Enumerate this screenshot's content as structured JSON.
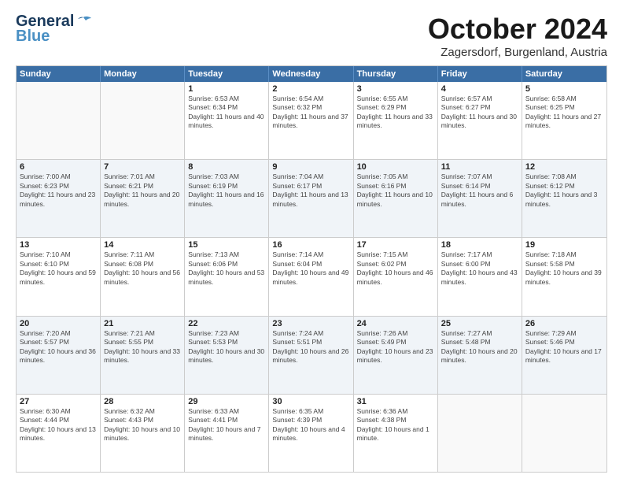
{
  "logo": {
    "line1": "General",
    "line2": "Blue"
  },
  "title": "October 2024",
  "subtitle": "Zagersdorf, Burgenland, Austria",
  "days": [
    "Sunday",
    "Monday",
    "Tuesday",
    "Wednesday",
    "Thursday",
    "Friday",
    "Saturday"
  ],
  "rows": [
    [
      {
        "day": "",
        "info": ""
      },
      {
        "day": "",
        "info": ""
      },
      {
        "day": "1",
        "info": "Sunrise: 6:53 AM\nSunset: 6:34 PM\nDaylight: 11 hours and 40 minutes."
      },
      {
        "day": "2",
        "info": "Sunrise: 6:54 AM\nSunset: 6:32 PM\nDaylight: 11 hours and 37 minutes."
      },
      {
        "day": "3",
        "info": "Sunrise: 6:55 AM\nSunset: 6:29 PM\nDaylight: 11 hours and 33 minutes."
      },
      {
        "day": "4",
        "info": "Sunrise: 6:57 AM\nSunset: 6:27 PM\nDaylight: 11 hours and 30 minutes."
      },
      {
        "day": "5",
        "info": "Sunrise: 6:58 AM\nSunset: 6:25 PM\nDaylight: 11 hours and 27 minutes."
      }
    ],
    [
      {
        "day": "6",
        "info": "Sunrise: 7:00 AM\nSunset: 6:23 PM\nDaylight: 11 hours and 23 minutes."
      },
      {
        "day": "7",
        "info": "Sunrise: 7:01 AM\nSunset: 6:21 PM\nDaylight: 11 hours and 20 minutes."
      },
      {
        "day": "8",
        "info": "Sunrise: 7:03 AM\nSunset: 6:19 PM\nDaylight: 11 hours and 16 minutes."
      },
      {
        "day": "9",
        "info": "Sunrise: 7:04 AM\nSunset: 6:17 PM\nDaylight: 11 hours and 13 minutes."
      },
      {
        "day": "10",
        "info": "Sunrise: 7:05 AM\nSunset: 6:16 PM\nDaylight: 11 hours and 10 minutes."
      },
      {
        "day": "11",
        "info": "Sunrise: 7:07 AM\nSunset: 6:14 PM\nDaylight: 11 hours and 6 minutes."
      },
      {
        "day": "12",
        "info": "Sunrise: 7:08 AM\nSunset: 6:12 PM\nDaylight: 11 hours and 3 minutes."
      }
    ],
    [
      {
        "day": "13",
        "info": "Sunrise: 7:10 AM\nSunset: 6:10 PM\nDaylight: 10 hours and 59 minutes."
      },
      {
        "day": "14",
        "info": "Sunrise: 7:11 AM\nSunset: 6:08 PM\nDaylight: 10 hours and 56 minutes."
      },
      {
        "day": "15",
        "info": "Sunrise: 7:13 AM\nSunset: 6:06 PM\nDaylight: 10 hours and 53 minutes."
      },
      {
        "day": "16",
        "info": "Sunrise: 7:14 AM\nSunset: 6:04 PM\nDaylight: 10 hours and 49 minutes."
      },
      {
        "day": "17",
        "info": "Sunrise: 7:15 AM\nSunset: 6:02 PM\nDaylight: 10 hours and 46 minutes."
      },
      {
        "day": "18",
        "info": "Sunrise: 7:17 AM\nSunset: 6:00 PM\nDaylight: 10 hours and 43 minutes."
      },
      {
        "day": "19",
        "info": "Sunrise: 7:18 AM\nSunset: 5:58 PM\nDaylight: 10 hours and 39 minutes."
      }
    ],
    [
      {
        "day": "20",
        "info": "Sunrise: 7:20 AM\nSunset: 5:57 PM\nDaylight: 10 hours and 36 minutes."
      },
      {
        "day": "21",
        "info": "Sunrise: 7:21 AM\nSunset: 5:55 PM\nDaylight: 10 hours and 33 minutes."
      },
      {
        "day": "22",
        "info": "Sunrise: 7:23 AM\nSunset: 5:53 PM\nDaylight: 10 hours and 30 minutes."
      },
      {
        "day": "23",
        "info": "Sunrise: 7:24 AM\nSunset: 5:51 PM\nDaylight: 10 hours and 26 minutes."
      },
      {
        "day": "24",
        "info": "Sunrise: 7:26 AM\nSunset: 5:49 PM\nDaylight: 10 hours and 23 minutes."
      },
      {
        "day": "25",
        "info": "Sunrise: 7:27 AM\nSunset: 5:48 PM\nDaylight: 10 hours and 20 minutes."
      },
      {
        "day": "26",
        "info": "Sunrise: 7:29 AM\nSunset: 5:46 PM\nDaylight: 10 hours and 17 minutes."
      }
    ],
    [
      {
        "day": "27",
        "info": "Sunrise: 6:30 AM\nSunset: 4:44 PM\nDaylight: 10 hours and 13 minutes."
      },
      {
        "day": "28",
        "info": "Sunrise: 6:32 AM\nSunset: 4:43 PM\nDaylight: 10 hours and 10 minutes."
      },
      {
        "day": "29",
        "info": "Sunrise: 6:33 AM\nSunset: 4:41 PM\nDaylight: 10 hours and 7 minutes."
      },
      {
        "day": "30",
        "info": "Sunrise: 6:35 AM\nSunset: 4:39 PM\nDaylight: 10 hours and 4 minutes."
      },
      {
        "day": "31",
        "info": "Sunrise: 6:36 AM\nSunset: 4:38 PM\nDaylight: 10 hours and 1 minute."
      },
      {
        "day": "",
        "info": ""
      },
      {
        "day": "",
        "info": ""
      }
    ]
  ]
}
